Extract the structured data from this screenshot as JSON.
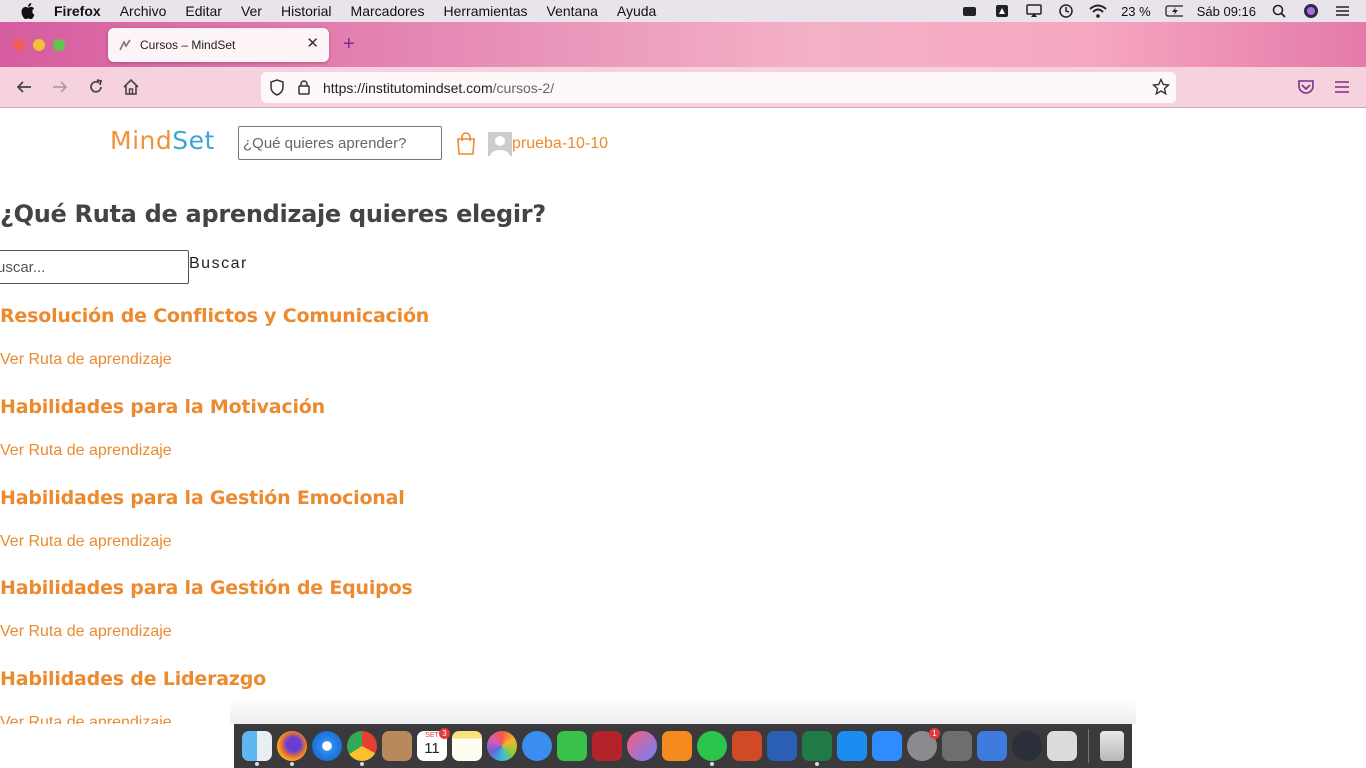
{
  "menubar": {
    "app_name": "Firefox",
    "items": [
      "Archivo",
      "Editar",
      "Ver",
      "Historial",
      "Marcadores",
      "Herramientas",
      "Ventana",
      "Ayuda"
    ],
    "battery": "23 %",
    "clock": "Sáb 09:16"
  },
  "browser": {
    "tab_title": "Cursos – MindSet",
    "url_host": "https://institutomindset.com",
    "url_path": "/cursos-2/"
  },
  "site": {
    "logo_part1": "Mind",
    "logo_part2": "Set",
    "header_search_placeholder": "¿Qué quieres aprender?",
    "username": "prueba-10-10"
  },
  "main": {
    "title": "¿Qué Ruta de aprendizaje quieres elegir?",
    "search_placeholder": "uscar...",
    "search_button": "Buscar",
    "courses": [
      {
        "title": "Resolución de Conflictos y Comunicación",
        "link": "Ver Ruta de aprendizaje"
      },
      {
        "title": "Habilidades para la Motivación",
        "link": "Ver Ruta de aprendizaje"
      },
      {
        "title": "Habilidades para la Gestión Emocional",
        "link": "Ver Ruta de aprendizaje"
      },
      {
        "title": "Habilidades para la Gestión de Equipos",
        "link": "Ver Ruta de aprendizaje"
      },
      {
        "title": "Habilidades de Liderazgo",
        "link": "Ver Ruta de aprendizaje"
      }
    ]
  },
  "dock": {
    "calendar_badge": "3",
    "settings_badge": "1",
    "calendar_month": "SET",
    "calendar_day": "11",
    "icons": [
      "finder-icon",
      "firefox-icon",
      "safari-icon",
      "chrome-icon",
      "contacts-icon",
      "calendar-icon",
      "notes-icon",
      "photos-icon",
      "messages-icon",
      "facetime-icon",
      "photo-booth-icon",
      "music-icon",
      "books-icon",
      "whatsapp-icon",
      "powerpoint-icon",
      "word-icon",
      "excel-icon",
      "app-store-icon",
      "zoom-icon",
      "system-preferences-icon",
      "calculator-icon",
      "network-icon",
      "quicktime-icon",
      "screenshot-icon",
      "trash-icon"
    ]
  },
  "colors": {
    "accent": "#ec8a2f",
    "logo_blue": "#3aa6d8",
    "title_gray": "#444444"
  }
}
